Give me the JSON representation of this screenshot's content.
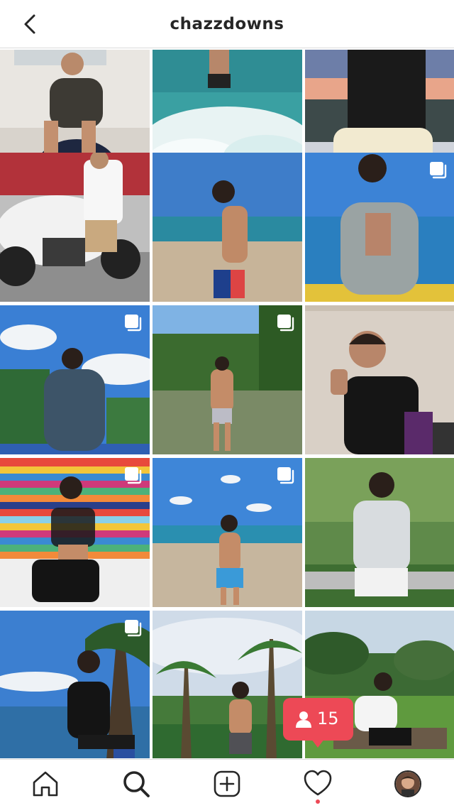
{
  "header": {
    "username": "chazzdowns",
    "back_icon": "chevron-left-icon"
  },
  "grid": {
    "posts": [
      {
        "alt_scene": "indoor-chair",
        "multi": false
      },
      {
        "alt_scene": "beach-waves",
        "multi": false
      },
      {
        "alt_scene": "sunset-city",
        "multi": false
      },
      {
        "alt_scene": "motorcycle",
        "multi": false
      },
      {
        "alt_scene": "beach-shirtless",
        "multi": false
      },
      {
        "alt_scene": "marina",
        "multi": true
      },
      {
        "alt_scene": "sky-hoodie",
        "multi": true
      },
      {
        "alt_scene": "mangrove-water",
        "multi": true
      },
      {
        "alt_scene": "cologne-indoor",
        "multi": false
      },
      {
        "alt_scene": "striped-wall",
        "multi": true
      },
      {
        "alt_scene": "beach-shorts",
        "multi": true
      },
      {
        "alt_scene": "garden-bench",
        "multi": false
      },
      {
        "alt_scene": "palm-sea",
        "multi": true
      },
      {
        "alt_scene": "palm-beach",
        "multi": false
      },
      {
        "alt_scene": "park-trees",
        "multi": false
      }
    ]
  },
  "activity": {
    "followers_count": "15",
    "icon": "person-icon",
    "color": "#ed4956"
  },
  "nav": {
    "items": [
      "home-icon",
      "search-icon",
      "new-post-icon",
      "heart-icon",
      "profile-avatar"
    ],
    "accent": "#ed4956"
  }
}
